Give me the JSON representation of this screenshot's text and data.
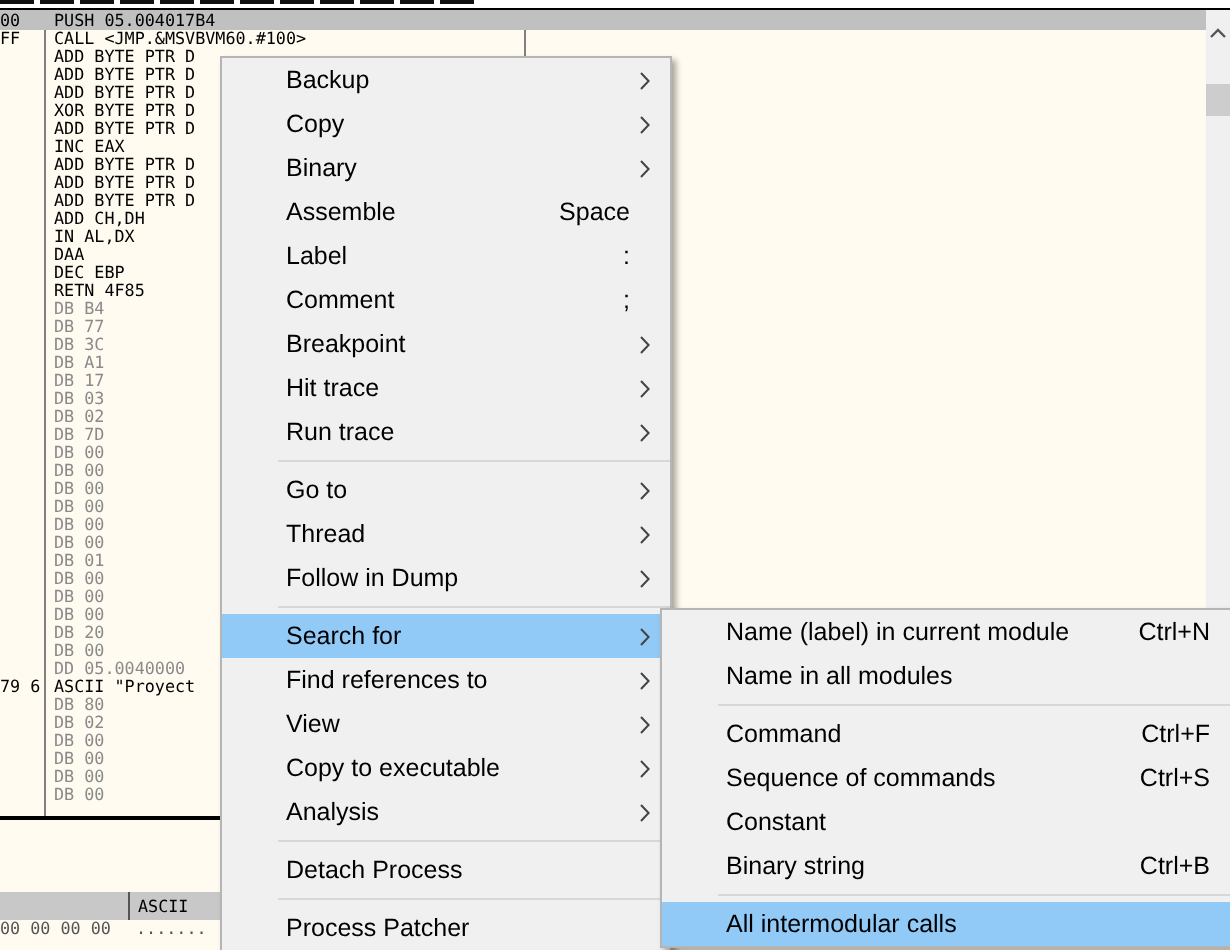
{
  "disassembly": {
    "rows": [
      {
        "address": "00",
        "command": "PUSH 05.004017B4",
        "kind": "code",
        "selected": true
      },
      {
        "address": "FF",
        "command": "CALL <JMP.&MSVBVM60.#100>",
        "kind": "code",
        "selected": false
      },
      {
        "command": "ADD BYTE PTR D",
        "kind": "code",
        "selected": false
      },
      {
        "command": "ADD BYTE PTR D",
        "kind": "code",
        "selected": false
      },
      {
        "command": "ADD BYTE PTR D",
        "kind": "code",
        "selected": false
      },
      {
        "command": "XOR BYTE PTR D",
        "kind": "code",
        "selected": false
      },
      {
        "command": "ADD BYTE PTR D",
        "kind": "code",
        "selected": false
      },
      {
        "command": "INC EAX",
        "kind": "code",
        "selected": false
      },
      {
        "command": "ADD BYTE PTR D",
        "kind": "code",
        "selected": false
      },
      {
        "command": "ADD BYTE PTR D",
        "kind": "code",
        "selected": false
      },
      {
        "command": "ADD BYTE PTR D",
        "kind": "code",
        "selected": false
      },
      {
        "command": "ADD CH,DH",
        "kind": "code",
        "selected": false
      },
      {
        "command": "IN AL,DX",
        "kind": "code",
        "selected": false
      },
      {
        "command": "DAA",
        "kind": "code",
        "selected": false
      },
      {
        "command": "DEC EBP",
        "kind": "code",
        "selected": false
      },
      {
        "command": "RETN 4F85",
        "kind": "code",
        "selected": false
      },
      {
        "command": "DB B4",
        "kind": "data",
        "selected": false
      },
      {
        "command": "DB 77",
        "kind": "data",
        "selected": false
      },
      {
        "command": "DB 3C",
        "kind": "data",
        "selected": false
      },
      {
        "command": "DB A1",
        "kind": "data",
        "selected": false
      },
      {
        "command": "DB 17",
        "kind": "data",
        "selected": false
      },
      {
        "command": "DB 03",
        "kind": "data",
        "selected": false
      },
      {
        "command": "DB 02",
        "kind": "data",
        "selected": false
      },
      {
        "command": "DB 7D",
        "kind": "data",
        "selected": false
      },
      {
        "command": "DB 00",
        "kind": "data",
        "selected": false
      },
      {
        "command": "DB 00",
        "kind": "data",
        "selected": false
      },
      {
        "command": "DB 00",
        "kind": "data",
        "selected": false
      },
      {
        "command": "DB 00",
        "kind": "data",
        "selected": false
      },
      {
        "command": "DB 00",
        "kind": "data",
        "selected": false
      },
      {
        "command": "DB 00",
        "kind": "data",
        "selected": false
      },
      {
        "command": "DB 01",
        "kind": "data",
        "selected": false
      },
      {
        "command": "DB 00",
        "kind": "data",
        "selected": false
      },
      {
        "command": "DB 00",
        "kind": "data",
        "selected": false
      },
      {
        "command": "DB 00",
        "kind": "data",
        "selected": false
      },
      {
        "command": "DB 20",
        "kind": "data",
        "selected": false
      },
      {
        "command": "DB 00",
        "kind": "data",
        "selected": false
      },
      {
        "command": "DD 05.0040000",
        "kind": "data",
        "selected": false
      },
      {
        "address": "79 6",
        "command": "ASCII \"Proyect",
        "kind": "code",
        "selected": false
      },
      {
        "command": "DB 80",
        "kind": "data",
        "selected": false
      },
      {
        "command": "DB 02",
        "kind": "data",
        "selected": false
      },
      {
        "command": "DB 00",
        "kind": "data",
        "selected": false
      },
      {
        "command": "DB 00",
        "kind": "data",
        "selected": false
      },
      {
        "command": "DB 00",
        "kind": "data",
        "selected": false
      },
      {
        "command": "DB 00",
        "kind": "data",
        "selected": false
      }
    ]
  },
  "dump": {
    "header": "ASCII",
    "rows": [
      {
        "hex": "00 00 00 00",
        "ascii": "......."
      }
    ]
  },
  "context_menu": {
    "groups": [
      [
        {
          "label": "Backup",
          "submenu": true,
          "selected": false
        },
        {
          "label": "Copy",
          "submenu": true,
          "selected": false
        },
        {
          "label": "Binary",
          "submenu": true,
          "selected": false
        },
        {
          "label": "Assemble",
          "shortcut": "Space",
          "submenu": false,
          "selected": false
        },
        {
          "label": "Label",
          "shortcut": ":",
          "submenu": false,
          "selected": false
        },
        {
          "label": "Comment",
          "shortcut": ";",
          "submenu": false,
          "selected": false
        },
        {
          "label": "Breakpoint",
          "submenu": true,
          "selected": false
        },
        {
          "label": "Hit trace",
          "submenu": true,
          "selected": false
        },
        {
          "label": "Run trace",
          "submenu": true,
          "selected": false
        }
      ],
      [
        {
          "label": "Go to",
          "submenu": true,
          "selected": false
        },
        {
          "label": "Thread",
          "submenu": true,
          "selected": false
        },
        {
          "label": "Follow in Dump",
          "submenu": true,
          "selected": false
        }
      ],
      [
        {
          "label": "Search for",
          "submenu": true,
          "selected": true
        },
        {
          "label": "Find references to",
          "submenu": true,
          "selected": false
        },
        {
          "label": "View",
          "submenu": true,
          "selected": false
        },
        {
          "label": "Copy to executable",
          "submenu": true,
          "selected": false
        },
        {
          "label": "Analysis",
          "submenu": true,
          "selected": false
        }
      ],
      [
        {
          "label": "Detach Process",
          "submenu": false,
          "selected": false
        }
      ],
      [
        {
          "label": "Process Patcher",
          "submenu": false,
          "selected": false
        }
      ]
    ]
  },
  "submenu": {
    "groups": [
      [
        {
          "label": "Name (label) in current module",
          "shortcut": "Ctrl+N",
          "selected": false
        },
        {
          "label": "Name in all modules",
          "selected": false
        }
      ],
      [
        {
          "label": "Command",
          "shortcut": "Ctrl+F",
          "selected": false
        },
        {
          "label": "Sequence of commands",
          "shortcut": "Ctrl+S",
          "selected": false
        },
        {
          "label": "Constant",
          "selected": false
        },
        {
          "label": "Binary string",
          "shortcut": "Ctrl+B",
          "selected": false
        }
      ],
      [
        {
          "label": "All intermodular calls",
          "selected": true
        }
      ]
    ]
  }
}
